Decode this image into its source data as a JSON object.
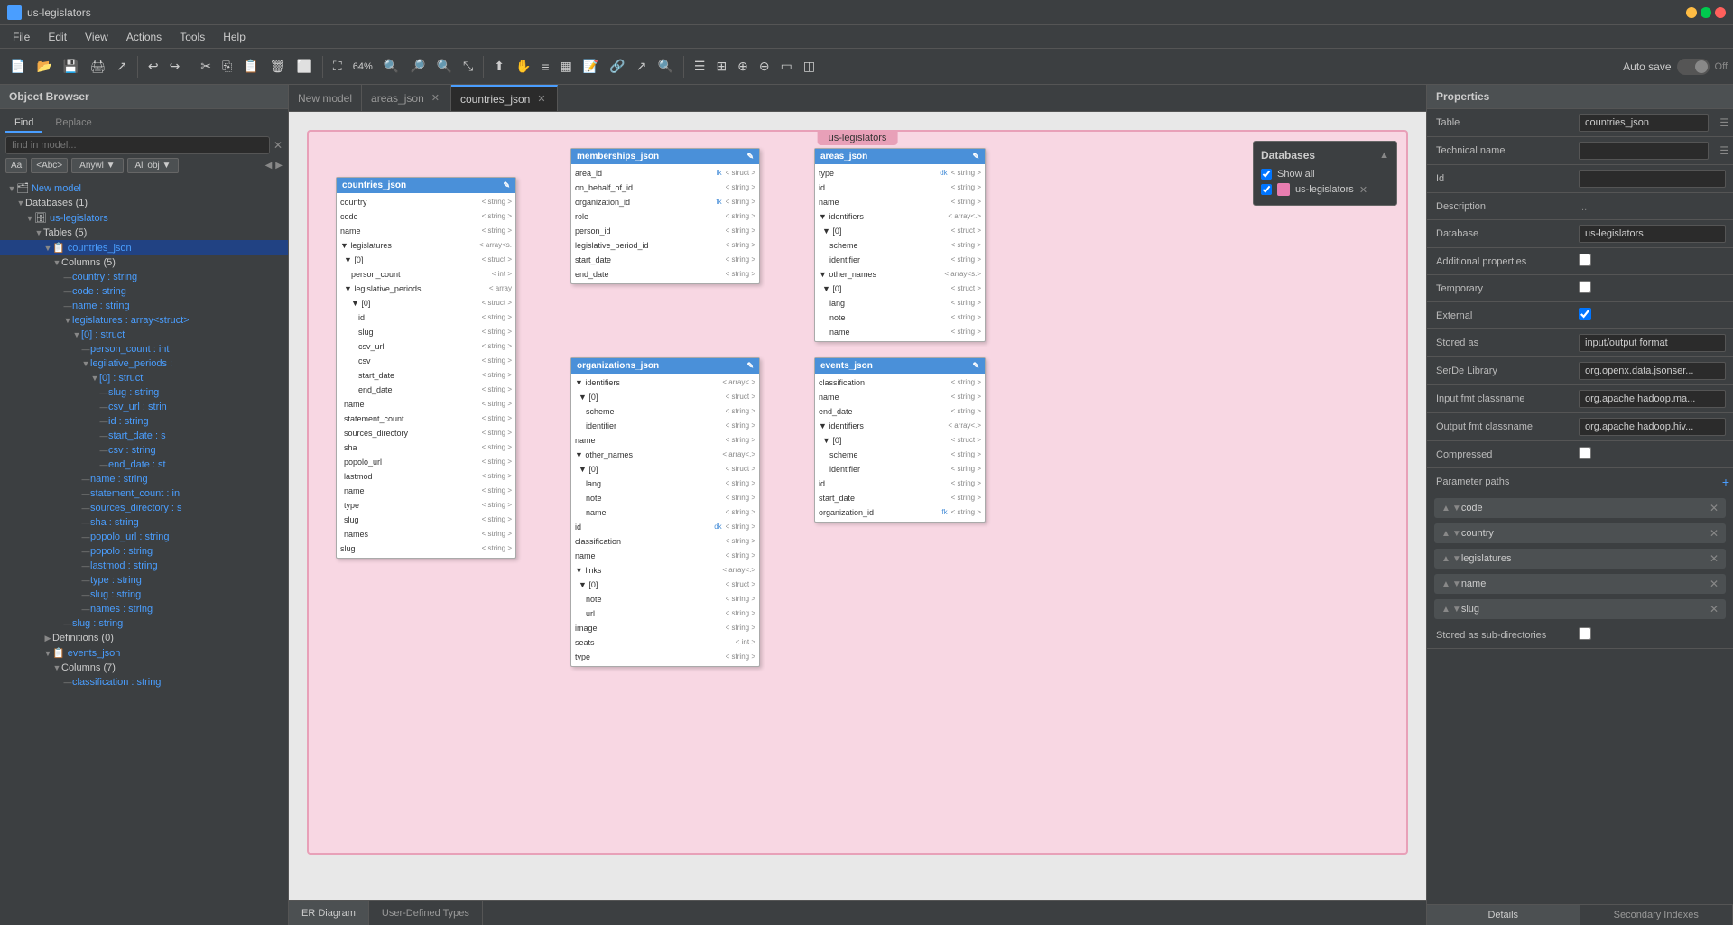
{
  "titleBar": {
    "appName": "us-legislators"
  },
  "menuBar": {
    "items": [
      "File",
      "Edit",
      "View",
      "Actions",
      "Tools",
      "Help"
    ]
  },
  "toolbar": {
    "zoomLevel": "64%",
    "autosave": "Auto save",
    "off": "Off"
  },
  "tabs": {
    "items": [
      {
        "label": "New model",
        "closable": false,
        "active": false
      },
      {
        "label": "areas_json",
        "closable": true,
        "active": false
      },
      {
        "label": "countries_json",
        "closable": true,
        "active": true
      }
    ]
  },
  "bottomTabs": {
    "items": [
      "ER Diagram",
      "User-Defined Types"
    ]
  },
  "sidebar": {
    "header": "Object Browser",
    "findLabel": "Find",
    "replaceLabel": "Replace",
    "searchPlaceholder": "find in model...",
    "options": [
      "Aa",
      "<Abc>",
      "Anywl ▼",
      "All obj ▼"
    ],
    "tree": {
      "newModel": "New model",
      "databases": "Databases (1)",
      "usLegislators": "us-legislators",
      "tables": "Tables (5)",
      "countriesJson": "countries_json",
      "columns": "Columns (5)",
      "fields": [
        "country : string",
        "code : string",
        "name : string",
        "legislatures : array<struct>",
        "[0] : struct",
        "person_count : int",
        "legilative_periods :",
        "[0] : struct",
        "slug : string",
        "csv_url : strin",
        "id : string",
        "start_date : s",
        "csv : string",
        "end_date : st",
        "name : string",
        "statement_count : in",
        "sources_directory : s",
        "sha : string",
        "popolo_url : string",
        "popolo : string",
        "lastmod : string",
        "type : string",
        "slug : string",
        "names : string"
      ],
      "slugString": "slug : string",
      "definitions": "Definitions (0)",
      "eventsJson": "events_json",
      "eventsColumns": "Columns (7)",
      "classificationString": "classification : string"
    }
  },
  "diagram": {
    "schemaName": "us-legislators",
    "databases": {
      "header": "Databases",
      "showAll": "Show all",
      "entry": "us-legislators"
    },
    "tables": {
      "countriesJson": {
        "title": "countries_json",
        "fields": [
          {
            "name": "country",
            "type": "< string >"
          },
          {
            "name": "code",
            "type": "< string >"
          },
          {
            "name": "name",
            "type": "< string >"
          },
          {
            "name": "▼ legislatures",
            "type": "< array<s."
          },
          {
            "name": "  ▼ [0]",
            "type": "< struct >"
          },
          {
            "name": "    person_count",
            "type": "< int >"
          },
          {
            "name": "  ▼ legislative_periods",
            "type": "< array<."
          },
          {
            "name": "    ▼ [0]",
            "type": "< struct >"
          },
          {
            "name": "      id",
            "type": "< string >"
          },
          {
            "name": "      slug",
            "type": "< string >"
          },
          {
            "name": "      csv_url",
            "type": "< string >"
          },
          {
            "name": "      csv",
            "type": "< string >"
          },
          {
            "name": "      start_date",
            "type": "< string >"
          },
          {
            "name": "      end_date",
            "type": "< string >"
          },
          {
            "name": "  name",
            "type": "< string >"
          },
          {
            "name": "  statement_count",
            "type": "< string >"
          },
          {
            "name": "  sources_directory",
            "type": "< string >"
          },
          {
            "name": "  sha",
            "type": "< string >"
          },
          {
            "name": "  popolo_url",
            "type": "< string >"
          },
          {
            "name": "  lastmod",
            "type": "< string >"
          },
          {
            "name": "  name",
            "type": "< string >"
          },
          {
            "name": "  type",
            "type": "< string >"
          },
          {
            "name": "  slug",
            "type": "< string >"
          },
          {
            "name": "  names",
            "type": "< string >"
          },
          {
            "name": "slug",
            "type": "< string >"
          }
        ]
      },
      "membershipsJson": {
        "title": "memberships_json",
        "fields": [
          {
            "name": "area_id",
            "type": "fk",
            "type2": "< struct >"
          },
          {
            "name": "on_behalf_of_id",
            "type": "",
            "type2": "< string >"
          },
          {
            "name": "organization_id",
            "type": "fk",
            "type2": "< string >"
          },
          {
            "name": "role",
            "type": "",
            "type2": "< string >"
          },
          {
            "name": "person_id",
            "type": "",
            "type2": "< string >"
          },
          {
            "name": "legislative_period_id",
            "type": "",
            "type2": "< string >"
          },
          {
            "name": "start_date",
            "type": "",
            "type2": "< string >"
          },
          {
            "name": "end_date",
            "type": "",
            "type2": "< string >"
          }
        ]
      },
      "areasJson": {
        "title": "areas_json",
        "fields": [
          {
            "name": "type",
            "type": "dk",
            "type2": "< string >"
          },
          {
            "name": "id",
            "type": "",
            "type2": "< string >"
          },
          {
            "name": "name",
            "type": "",
            "type2": "< string >"
          },
          {
            "name": "▼ identifiers",
            "type": "",
            "type2": "< array<.>"
          },
          {
            "name": "  ▼ [0]",
            "type": "",
            "type2": "< struct >"
          },
          {
            "name": "    scheme",
            "type": "",
            "type2": "< string >"
          },
          {
            "name": "    identifier",
            "type": "",
            "type2": "< string >"
          },
          {
            "name": "▼ other_names",
            "type": "",
            "type2": "< array<s.>"
          },
          {
            "name": "  ▼ [0]",
            "type": "",
            "type2": "< struct >"
          },
          {
            "name": "    lang",
            "type": "",
            "type2": "< string >"
          },
          {
            "name": "    note",
            "type": "",
            "type2": "< string >"
          },
          {
            "name": "    name",
            "type": "",
            "type2": "< string >"
          }
        ]
      },
      "organizationsJson": {
        "title": "organizations_json",
        "fields": [
          {
            "name": "▼ identifiers",
            "type": "",
            "type2": "< array<.>"
          },
          {
            "name": "  ▼ [0]",
            "type": "",
            "type2": "< struct >"
          },
          {
            "name": "    scheme",
            "type": "",
            "type2": "< string >"
          },
          {
            "name": "    identifier",
            "type": "",
            "type2": "< string >"
          },
          {
            "name": "name",
            "type": "",
            "type2": "< string >"
          },
          {
            "name": "▼ other_names",
            "type": "",
            "type2": "< array<.>"
          },
          {
            "name": "  ▼ [0]",
            "type": "",
            "type2": "< struct >"
          },
          {
            "name": "    lang",
            "type": "",
            "type2": "< string >"
          },
          {
            "name": "    note",
            "type": "",
            "type2": "< string >"
          },
          {
            "name": "    name",
            "type": "",
            "type2": "< string >"
          },
          {
            "name": "id",
            "type": "dk",
            "type2": "< string >"
          },
          {
            "name": "classification",
            "type": "",
            "type2": "< string >"
          },
          {
            "name": "name",
            "type": "",
            "type2": "< string >"
          },
          {
            "name": "▼ links",
            "type": "",
            "type2": "< array<.>"
          },
          {
            "name": "  ▼ [0]",
            "type": "",
            "type2": "< struct >"
          },
          {
            "name": "    note",
            "type": "",
            "type2": "< string >"
          },
          {
            "name": "    url",
            "type": "",
            "type2": "< string >"
          },
          {
            "name": "image",
            "type": "",
            "type2": "< string >"
          },
          {
            "name": "seats",
            "type": "",
            "type2": "< int >"
          },
          {
            "name": "type",
            "type": "",
            "type2": "< string >"
          }
        ]
      },
      "eventsJson": {
        "title": "events_json",
        "fields": [
          {
            "name": "classification",
            "type": "",
            "type2": "< string >"
          },
          {
            "name": "name",
            "type": "",
            "type2": "< string >"
          },
          {
            "name": "end_date",
            "type": "",
            "type2": "< string >"
          },
          {
            "name": "▼ identifiers",
            "type": "",
            "type2": "< array<.>"
          },
          {
            "name": "  ▼ [0]",
            "type": "",
            "type2": "< struct >"
          },
          {
            "name": "    scheme",
            "type": "",
            "type2": "< string >"
          },
          {
            "name": "    identifier",
            "type": "",
            "type2": "< string >"
          },
          {
            "name": "id",
            "type": "",
            "type2": "< string >"
          },
          {
            "name": "start_date",
            "type": "",
            "type2": "< string >"
          },
          {
            "name": "organization_id",
            "type": "fk",
            "type2": "< string >"
          }
        ]
      }
    }
  },
  "properties": {
    "header": "Properties",
    "fields": [
      {
        "label": "Table",
        "value": "countries_json",
        "type": "input"
      },
      {
        "label": "Technical name",
        "value": "",
        "type": "input"
      },
      {
        "label": "Id",
        "value": "",
        "type": "input"
      },
      {
        "label": "Description",
        "value": "",
        "type": "text-dots"
      },
      {
        "label": "Database",
        "value": "us-legislators",
        "type": "select"
      },
      {
        "label": "Additional properties",
        "value": false,
        "type": "checkbox"
      },
      {
        "label": "Temporary",
        "value": false,
        "type": "checkbox"
      },
      {
        "label": "External",
        "value": true,
        "type": "checkbox"
      },
      {
        "label": "Stored as",
        "value": "input/output format",
        "type": "select"
      },
      {
        "label": "SerDe Library",
        "value": "org.openx.data.jsonser...",
        "type": "input"
      },
      {
        "label": "Input fmt classname",
        "value": "org.apache.hadoop.ma...",
        "type": "input"
      },
      {
        "label": "Output fmt classname",
        "value": "org.apache.hadoop.hiv...",
        "type": "input"
      },
      {
        "label": "Compressed",
        "value": false,
        "type": "checkbox"
      },
      {
        "label": "Parameter paths",
        "value": "+",
        "type": "add"
      }
    ],
    "parameterPaths": [
      "code",
      "country",
      "legislatures",
      "name",
      "slug"
    ],
    "storedSubDirectories": {
      "label": "Stored as sub-directories",
      "checked": false
    },
    "bottomTabs": [
      "Details",
      "Secondary Indexes"
    ]
  },
  "rightPanelExtra": {
    "countryLabel": "country"
  }
}
